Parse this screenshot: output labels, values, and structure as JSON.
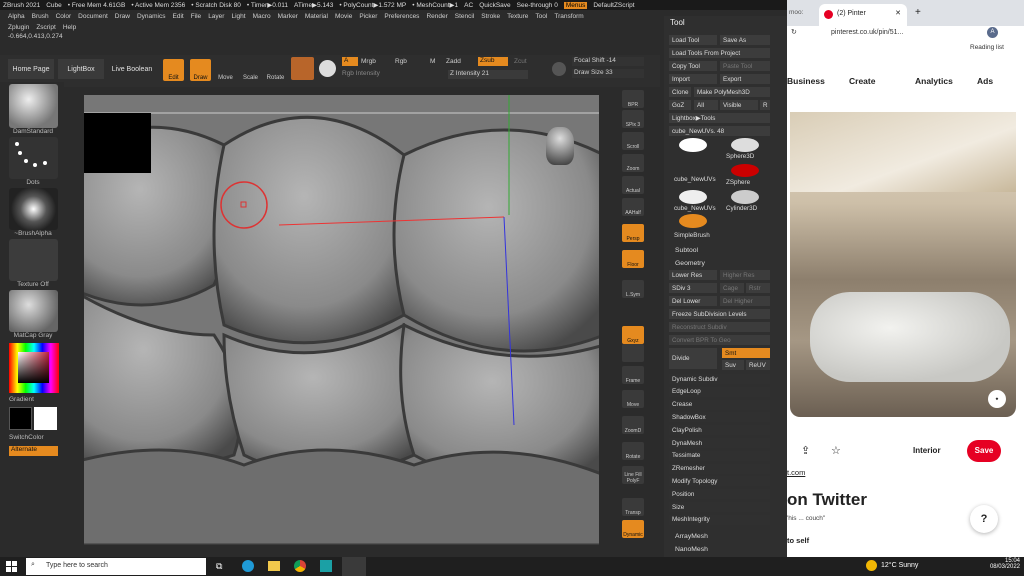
{
  "zbrush": {
    "title_items": [
      "ZBrush 2021",
      "Cube",
      "• Free Mem 4.61GB",
      "• Active Mem 2356",
      "• Scratch Disk 80",
      "• Timer▶0.011",
      "ATime▶5.143",
      "• PolyCount▶1.572 MP",
      "• MeshCount▶1",
      "AC",
      "QuickSave",
      "See-through  0",
      "Menus",
      "DefaultZScript"
    ],
    "menus": [
      "Alpha",
      "Brush",
      "Color",
      "Document",
      "Draw",
      "Dynamics",
      "Edit",
      "File",
      "Layer",
      "Light",
      "Macro",
      "Marker",
      "Material",
      "Movie",
      "Picker",
      "Preferences",
      "Render",
      "Stencil",
      "Stroke",
      "Texture",
      "Tool",
      "Transform"
    ],
    "menus2": [
      "Zplugin",
      "Zscript",
      "Help"
    ],
    "coords": "-0.664,0.413,0.274",
    "nav": {
      "home": "Home Page",
      "lightbox": "LightBox",
      "live_boolean": "Live Boolean"
    },
    "toolbar": {
      "edit": "Edit",
      "draw": "Draw",
      "move": "Move",
      "scale": "Scale",
      "rotate": "Rotate"
    },
    "color_controls": {
      "a": "A",
      "mrgb": "Mrgb",
      "rgb": "Rgb",
      "m": "M",
      "zadd": "Zadd",
      "zsub": "Zsub",
      "zcut": "Zcut",
      "rgb_intensity": "Rgb Intensity",
      "z_intensity": "Z Intensity 21",
      "focal_shift": "Focal Shift -14",
      "draw_size": "Draw Size 33"
    },
    "left": {
      "brush": "DamStandard",
      "stroke": "Dots",
      "alpha": "~BrushAlpha",
      "texture": "Texture Off",
      "material": "MatCap Gray",
      "gradient": "Gradient",
      "switch": "SwitchColor",
      "alternate": "Alternate"
    },
    "right_strip": [
      "BPR",
      "SPix 3",
      "Scroll",
      "Zoom",
      "Actual",
      "AAHalf",
      "Persp",
      "Floor",
      "L.Sym",
      "Gxyz",
      "",
      "Frame",
      "Move",
      "ZoomD",
      "Rotate",
      "Line Fill PolyF",
      "Transp",
      "Dynamic"
    ],
    "tool_panel": {
      "title": "Tool",
      "load_tool": "Load Tool",
      "save_as": "Save As",
      "load_project": "Load Tools From Project",
      "copy_tool": "Copy Tool",
      "paste_tool": "Paste Tool",
      "import": "Import",
      "export": "Export",
      "clone": "Clone",
      "make_polymesh": "Make PolyMesh3D",
      "goz": "GoZ",
      "all": "All",
      "visible": "Visible",
      "r": "R",
      "lightbox_tools": "Lightbox▶Tools",
      "current_tool": "cube_NewUVs. 48",
      "tools": [
        "cube_NewUVs",
        "Sphere3D",
        "ZSphere",
        "cube_NewUVs",
        "Cylinder3D",
        "SimpleBrush"
      ],
      "subtool": "Subtool",
      "geometry": "Geometry",
      "lower_res": "Lower Res",
      "higher_res": "Higher Res",
      "sdiv": "SDiv 3",
      "cage": "Cage",
      "rstr": "Rstr",
      "del_lower": "Del Lower",
      "del_higher": "Del Higher",
      "freeze": "Freeze SubDivision Levels",
      "reconstruct": "Reconstruct Subdiv",
      "convert_bpr": "Convert BPR To Geo",
      "divide": "Divide",
      "smt": "Smt",
      "suv": "Suv",
      "reuv": "ReUV",
      "sections": [
        "Dynamic Subdiv",
        "EdgeLoop",
        "Crease",
        "ShadowBox",
        "ClayPolish",
        "DynaMesh",
        "Tessimate",
        "ZRemesher",
        "Modify Topology",
        "Position",
        "Size",
        "MeshIntegrity"
      ],
      "arraymesh": "ArrayMesh",
      "nanomesh": "NanoMesh"
    }
  },
  "browser": {
    "tab_small": "moo:",
    "tab_title": "(2) Pinter",
    "url": "pinterest.co.uk/pin/51...",
    "reading_list": "Reading list",
    "nav": [
      "Business",
      "Create",
      "Analytics",
      "Ads"
    ],
    "category": "Interior",
    "save": "Save",
    "link_text": "t.com",
    "heading": "on Twitter",
    "quote": "'his ... couch\"",
    "sub": "to self",
    "help": "?"
  },
  "taskbar": {
    "search": "Type here to search",
    "weather": "12°C  Sunny",
    "time": "15:04",
    "date": "08/03/2022"
  },
  "colors": {
    "accent": "#e58a1f",
    "pinterest_red": "#e60023"
  }
}
